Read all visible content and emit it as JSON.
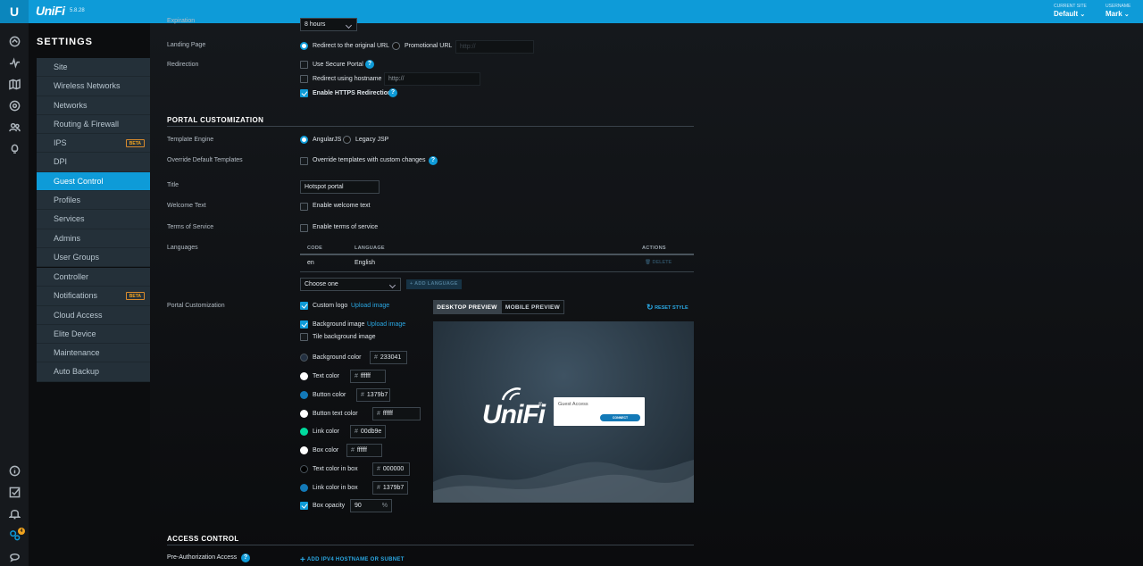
{
  "app": {
    "logo_letter": "U",
    "brand": "UniFi",
    "version": "5.8.28",
    "current_site_label": "CURRENT SITE",
    "current_site_value": "Default",
    "username_label": "USERNAME",
    "username_value": "Mark",
    "notifications_count": "4"
  },
  "sidebar": {
    "title": "SETTINGS",
    "site_items": [
      {
        "label": "Site"
      },
      {
        "label": "Wireless Networks"
      },
      {
        "label": "Networks"
      },
      {
        "label": "Routing & Firewall"
      },
      {
        "label": "IPS",
        "badge": "BETA"
      },
      {
        "label": "DPI"
      },
      {
        "label": "Guest Control",
        "active": true
      },
      {
        "label": "Profiles"
      },
      {
        "label": "Services"
      },
      {
        "label": "Admins"
      },
      {
        "label": "User Groups"
      }
    ],
    "controller_items": [
      {
        "label": "Controller"
      },
      {
        "label": "Notifications",
        "badge": "BETA"
      },
      {
        "label": "Cloud Access"
      },
      {
        "label": "Elite Device"
      },
      {
        "label": "Maintenance"
      },
      {
        "label": "Auto Backup"
      }
    ]
  },
  "form": {
    "expiration_label": "Expiration",
    "expiration_value": "8 hours",
    "landing_page_label": "Landing Page",
    "landing_redirect_original": "Redirect to the original URL",
    "landing_promotional": "Promotional URL",
    "promotional_placeholder": "http://",
    "redirection_label": "Redirection",
    "use_secure_portal": "Use Secure Portal",
    "redirect_hostname": "Redirect using hostname",
    "hostname_placeholder": "http://",
    "enable_https_redirection": "Enable HTTPS Redirection",
    "portal_customization_title": "PORTAL CUSTOMIZATION",
    "template_engine_label": "Template Engine",
    "template_angular": "AngularJS",
    "template_legacy": "Legacy JSP",
    "override_label": "Override Default Templates",
    "override_option": "Override templates with custom changes",
    "title_label": "Title",
    "title_value": "Hotspot portal",
    "welcome_label": "Welcome Text",
    "welcome_option": "Enable welcome text",
    "tos_label": "Terms of Service",
    "tos_option": "Enable terms of service",
    "languages_label": "Languages",
    "languages_table": {
      "headers": [
        "CODE",
        "LANGUAGE",
        "ACTIONS"
      ],
      "rows": [
        {
          "code": "en",
          "language": "English",
          "action": "DELETE"
        }
      ]
    },
    "language_select": "Choose one",
    "add_language": "ADD LANGUAGE",
    "portal_custom_label": "Portal Customization",
    "custom_logo": "Custom logo",
    "upload_image": "Upload image",
    "background_image": "Background image",
    "tile_background": "Tile background image",
    "colors": [
      {
        "label": "Background color",
        "value": "233041",
        "swatch": "#233041"
      },
      {
        "label": "Text color",
        "value": "ffffff",
        "swatch": "#ffffff"
      },
      {
        "label": "Button color",
        "value": "1379b7",
        "swatch": "#1379b7"
      },
      {
        "label": "Button text color",
        "value": "ffffff",
        "swatch": "#ffffff"
      },
      {
        "label": "Link color",
        "value": "00db9e",
        "swatch": "#00db9e"
      },
      {
        "label": "Box color",
        "value": "ffffff",
        "swatch": "#ffffff"
      },
      {
        "label": "Text color in box",
        "value": "000000",
        "swatch": "#000000"
      },
      {
        "label": "Link color in box",
        "value": "1379b7",
        "swatch": "#1379b7"
      }
    ],
    "hash": "#",
    "box_opacity_label": "Box opacity",
    "box_opacity_value": "90",
    "percent": "%",
    "desktop_preview": "DESKTOP PREVIEW",
    "mobile_preview": "MOBILE PREVIEW",
    "reset_style": "RESET STYLE",
    "preview_logo": "UniFi",
    "preview_reg": "®",
    "preview_box_text": "Guest Access",
    "preview_button": "CONNECT",
    "access_control_title": "ACCESS CONTROL",
    "pre_auth_label": "Pre-Authorization Access",
    "add_ipv4": "ADD IPV4 HOSTNAME OR SUBNET"
  },
  "colors": {
    "accent": "#0e9bd8",
    "beta": "#f0a31e"
  }
}
